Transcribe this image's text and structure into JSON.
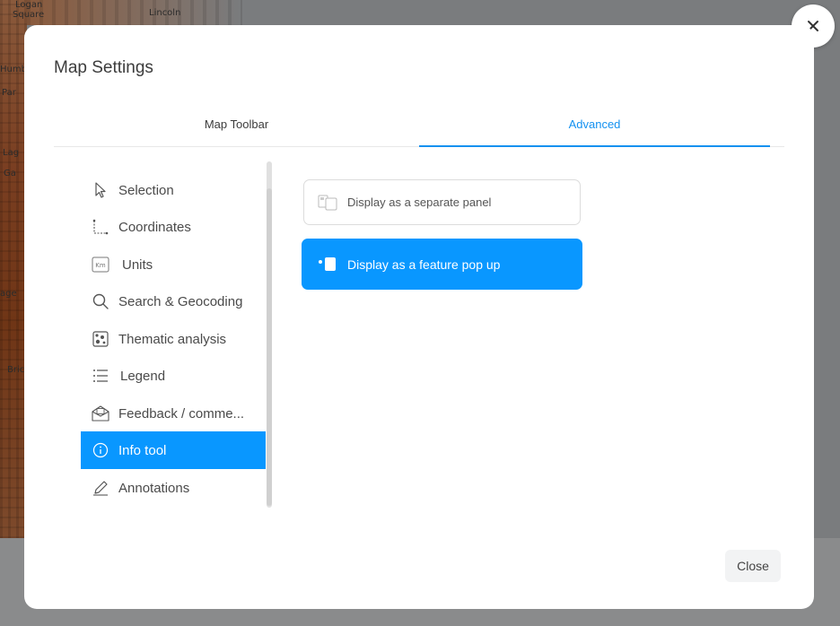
{
  "background_map": {
    "labels": [
      "Logan",
      "Square",
      "Lincoln",
      "Humbo",
      "Bric",
      "Par",
      "Lag",
      "Ga",
      "age"
    ]
  },
  "modal": {
    "title": "Map Settings",
    "close_label": "Close",
    "tabs": [
      {
        "label": "Map Toolbar",
        "active": false
      },
      {
        "label": "Advanced",
        "active": true
      }
    ],
    "sidebar_items": [
      {
        "label": "Selection",
        "icon": "cursor-icon",
        "active": false
      },
      {
        "label": "Coordinates",
        "icon": "coordinates-icon",
        "active": false
      },
      {
        "label": "Units",
        "icon": "km-units-icon",
        "active": false
      },
      {
        "label": "Search & Geocoding",
        "icon": "search-icon",
        "active": false
      },
      {
        "label": "Thematic analysis",
        "icon": "thematic-analysis-icon",
        "active": false
      },
      {
        "label": "Legend",
        "icon": "legend-list-icon",
        "active": false
      },
      {
        "label": "Feedback / comme...",
        "icon": "feedback-envelope-icon",
        "active": false
      },
      {
        "label": "Info tool",
        "icon": "info-icon",
        "active": true
      },
      {
        "label": "Annotations",
        "icon": "pencil-icon",
        "active": false
      }
    ],
    "display_options": [
      {
        "label": "Display as a separate panel",
        "icon": "separate-panel-icon",
        "selected": false
      },
      {
        "label": "Display as a feature pop up",
        "icon": "feature-popup-icon",
        "selected": true
      }
    ]
  },
  "colors": {
    "accent": "#0997ff",
    "tab_accent": "#1391f0",
    "overlay": "#6b6d70"
  }
}
